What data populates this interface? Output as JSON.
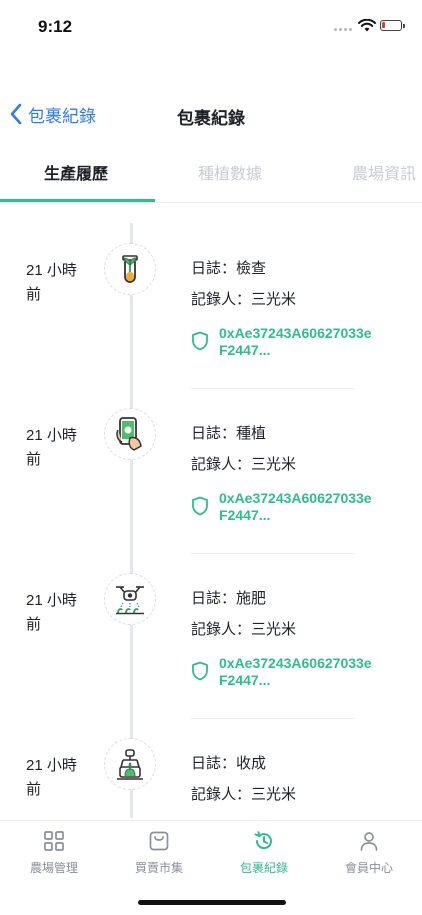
{
  "status_bar": {
    "time": "9:12"
  },
  "nav": {
    "back_label": "包裹紀錄",
    "title": "包裹紀錄"
  },
  "tabs": [
    {
      "label": "生產履歷",
      "active": true
    },
    {
      "label": "種植數據",
      "active": false
    },
    {
      "label": "農場資訊",
      "active": false
    }
  ],
  "colors": {
    "accent": "#2dbd8f",
    "link": "#2e7df0"
  },
  "timeline": [
    {
      "time": "21 小時前",
      "log": "日誌：檢查",
      "recorder": "記錄人：三光米",
      "hash": "0xAe37243A60627033eF2447...",
      "icon": "test-tube-plant-icon"
    },
    {
      "time": "21 小時前",
      "log": "日誌：種植",
      "recorder": "記錄人：三光米",
      "hash": "0xAe37243A60627033eF2447...",
      "icon": "phone-in-hand-icon"
    },
    {
      "time": "21 小時前",
      "log": "日誌：施肥",
      "recorder": "記錄人：三光米",
      "hash": "0xAe37243A60627033eF2447...",
      "icon": "drone-icon"
    },
    {
      "time": "21 小時前",
      "log": "日誌：收成",
      "recorder": "記錄人：三光米",
      "hash": "",
      "icon": "harvest-robot-icon"
    }
  ],
  "tabbar": [
    {
      "label": "農場管理",
      "icon": "grid-icon",
      "active": false
    },
    {
      "label": "買賣市集",
      "icon": "shopping-bag-icon",
      "active": false
    },
    {
      "label": "包裹紀錄",
      "icon": "history-icon",
      "active": true
    },
    {
      "label": "會員中心",
      "icon": "person-icon",
      "active": false
    }
  ]
}
